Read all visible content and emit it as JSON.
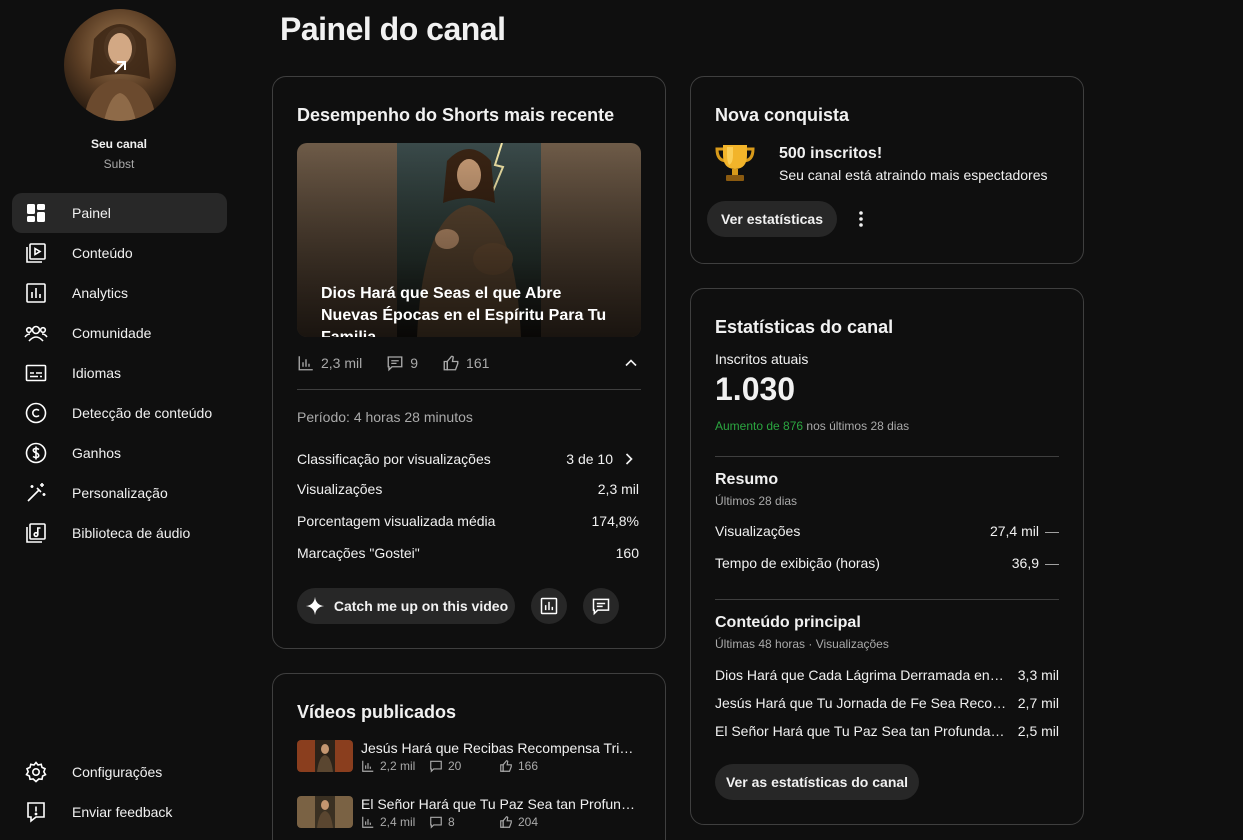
{
  "sidebar": {
    "channel_name": "Seu canal",
    "channel_handle": "Subst",
    "items": [
      {
        "label": "Painel",
        "icon": "dashboard-icon",
        "active": true
      },
      {
        "label": "Conteúdo",
        "icon": "content-icon"
      },
      {
        "label": "Analytics",
        "icon": "analytics-icon"
      },
      {
        "label": "Comunidade",
        "icon": "community-icon"
      },
      {
        "label": "Idiomas",
        "icon": "subtitles-icon"
      },
      {
        "label": "Detecção de conteúdo",
        "icon": "copyright-icon"
      },
      {
        "label": "Ganhos",
        "icon": "dollar-icon"
      },
      {
        "label": "Personalização",
        "icon": "magic-wand-icon"
      },
      {
        "label": "Biblioteca de áudio",
        "icon": "audio-library-icon"
      }
    ],
    "bottom_items": [
      {
        "label": "Configurações",
        "icon": "gear-icon"
      },
      {
        "label": "Enviar feedback",
        "icon": "feedback-icon"
      }
    ]
  },
  "page_title": "Painel do canal",
  "shorts_card": {
    "title": "Desempenho do Shorts mais recente",
    "video_title": "Dios Hará que Seas el que Abre Nuevas Épocas en el Espíritu Para Tu Familia",
    "views": "2,3 mil",
    "comments": "9",
    "likes": "161",
    "period": "Período: 4 horas 28 minutos",
    "metrics": [
      {
        "label": "Classificação por visualizações",
        "value": "3 de 10"
      },
      {
        "label": "Visualizações",
        "value": "2,3 mil"
      },
      {
        "label": "Porcentagem visualizada média",
        "value": "174,8%"
      },
      {
        "label": "Marcações \"Gostei\"",
        "value": "160"
      }
    ],
    "catch_up_label": "Catch me up on this video"
  },
  "published_card": {
    "title": "Vídeos publicados",
    "videos": [
      {
        "title": "Jesús Hará que Recibas Recompensa Triple por Tu Fe",
        "views": "2,2 mil",
        "comments": "20",
        "likes": "166"
      },
      {
        "title": "El Señor Hará que Tu Paz Sea tan Profunda que Nada te Perturbe",
        "views": "2,4 mil",
        "comments": "8",
        "likes": "204"
      }
    ]
  },
  "achievement_card": {
    "title": "Nova conquista",
    "headline": "500 inscritos!",
    "subtitle": "Seu canal está atraindo mais espectadores",
    "button_label": "Ver estatísticas"
  },
  "stats_card": {
    "title": "Estatísticas do canal",
    "subs_label": "Inscritos atuais",
    "subs_value": "1.030",
    "delta_green": "Aumento de 876",
    "delta_rest": " nos últimos 28 dias",
    "summary_title": "Resumo",
    "summary_sub": "Últimos 28 dias",
    "summary_metrics": [
      {
        "label": "Visualizações",
        "value": "27,4 mil",
        "trend": "—"
      },
      {
        "label": "Tempo de exibição (horas)",
        "value": "36,9",
        "trend": "—"
      }
    ],
    "top_title": "Conteúdo principal",
    "top_sub": "Últimas 48 horas · Visualizações",
    "top_items": [
      {
        "title": "Dios Hará que Cada Lágrima Derramada en Oración sea Recompensada",
        "value": "3,3 mil"
      },
      {
        "title": "Jesús Hará que Tu Jornada de Fe Sea Recompensada",
        "value": "2,7 mil"
      },
      {
        "title": "El Señor Hará que Tu Paz Sea tan Profunda que Nada te Perturbe",
        "value": "2,5 mil"
      }
    ],
    "button_label": "Ver as estatísticas do canal"
  },
  "colors": {
    "background": "#0f0f0f",
    "card_border": "#3f3f3f",
    "accent_green": "#2ba640",
    "pill_bg": "#272727"
  }
}
